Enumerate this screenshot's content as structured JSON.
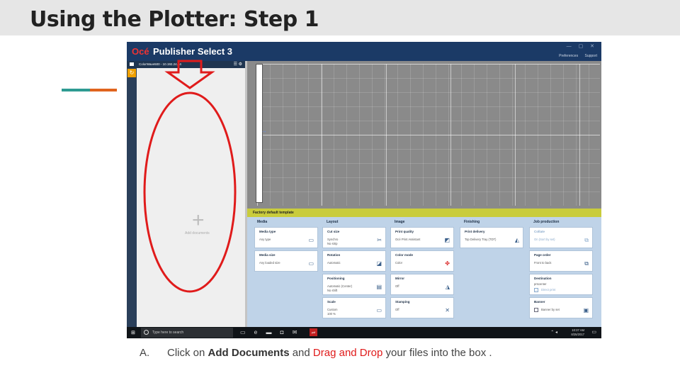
{
  "slide": {
    "title": "Using the Plotter: Step 1",
    "caption": {
      "letter": "A.",
      "part1": "Click on ",
      "bold": "Add Documents",
      "part2": " and ",
      "red": "Drag and Drop",
      "part3": " your files into the box ."
    },
    "colors": {
      "accent_teal": "#2e9b92",
      "accent_orange": "#e0641e",
      "annotation_red": "#e01b1b"
    }
  },
  "app": {
    "brand": "Océ",
    "name": "Publisher Select 3",
    "links": [
      "Preferences",
      "Support"
    ],
    "printer": "ColorWave500 - 10.192.24.24",
    "add_documents_label": "Add documents",
    "template_label": "Factory default template",
    "columns": [
      "Media",
      "Layout",
      "Image",
      "Finishing",
      "Job production"
    ],
    "cards": {
      "media_type": {
        "title": "Media type",
        "value": "Any type",
        "icon": "media-icon"
      },
      "media_size": {
        "title": "Media size",
        "value": "Any loaded size",
        "icon": "media-icon"
      },
      "cut_size": {
        "title": "Cut size",
        "value": "Synchro\nNo strip",
        "icon": "cut-icon"
      },
      "rotation": {
        "title": "Rotation",
        "value": "Automatic",
        "icon": "rotate-icon"
      },
      "positioning": {
        "title": "Positioning",
        "value": "Automatic (Center)\nNo shift",
        "icon": "position-icon"
      },
      "scale": {
        "title": "Scale",
        "value": "Custom\n100 %",
        "icon": "scale-icon"
      },
      "print_quality": {
        "title": "Print quality",
        "value": "Océ Print Assistant",
        "icon": "quality-icon"
      },
      "color_mode": {
        "title": "Color mode",
        "value": "Color",
        "icon": "color-icon"
      },
      "mirror": {
        "title": "Mirror",
        "value": "Off",
        "icon": "mirror-icon"
      },
      "stamping": {
        "title": "Stamping",
        "value": "Off",
        "icon": "stamp-icon"
      },
      "print_delivery": {
        "title": "Print delivery",
        "value": "Top Delivery Tray (TDT)",
        "icon": "tray-icon"
      },
      "collate": {
        "title": "Collate",
        "value": "On (Sort by set)",
        "icon": "collate-icon"
      },
      "page_order": {
        "title": "Page order",
        "value": "Front to back",
        "icon": "order-icon"
      },
      "destination": {
        "title": "Destination",
        "value": "prscenter",
        "extra": "Direct print",
        "icon": "check-icon"
      },
      "banner": {
        "title": "Banner",
        "value": "Banner by set",
        "icon": "banner-icon"
      }
    }
  },
  "taskbar": {
    "search_placeholder": "Type here to search",
    "time": "10:37 AM",
    "date": "8/25/2017",
    "red_app_label": "pdf"
  }
}
